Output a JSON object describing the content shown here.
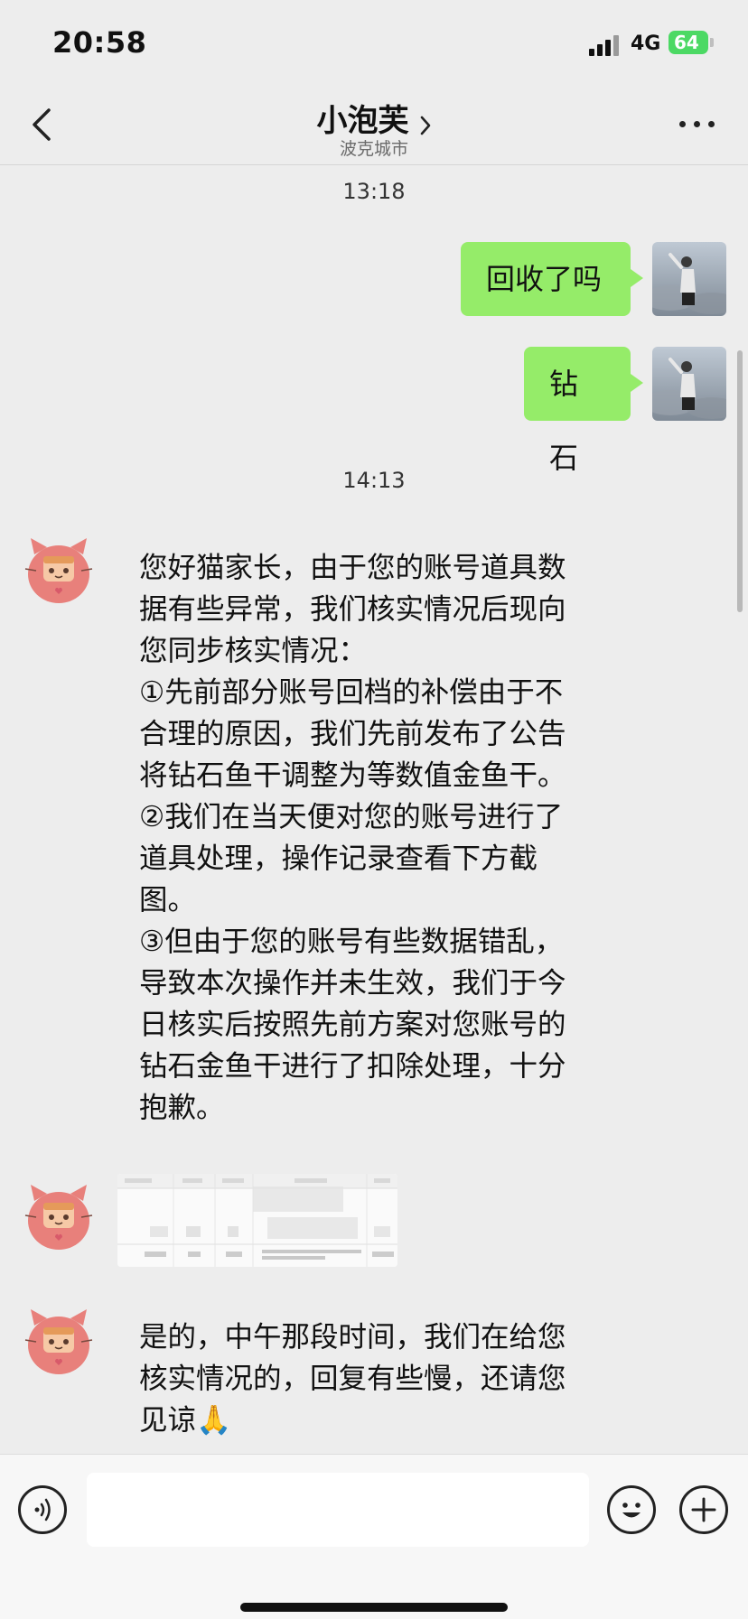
{
  "status_bar": {
    "time": "20:58",
    "network": "4G",
    "battery": "64"
  },
  "nav": {
    "title": "小泡芙",
    "subtitle": "波克城市"
  },
  "messages": {
    "timestamp_1": "13:18",
    "out_1": "回收了吗",
    "out_2": "钻石",
    "timestamp_2": "14:13",
    "in_1": [
      "您好猫家长，由于您的账号道具数",
      "据有些异常，我们核实情况后现向",
      "您同步核实情况：",
      "①先前部分账号回档的补偿由于不",
      "合理的原因，我们先前发布了公告",
      "将钻石鱼干调整为等数值金鱼干。",
      "②我们在当天便对您的账号进行了",
      "道具处理，操作记录查看下方截",
      "图。",
      "③但由于您的账号有些数据错乱，",
      "导致本次操作并未生效，我们于今",
      "日核实后按照先前方案对您账号的",
      "钻石金鱼干进行了扣除处理，十分",
      "抱歉。"
    ],
    "in_image_caption": "",
    "in_3": [
      "是的，中午那段时间，我们在给您",
      "核实情况的，回复有些慢，还请您",
      "见谅🙏"
    ]
  },
  "icons": {
    "back": "chevron-left-icon",
    "more": "more-dots-icon",
    "voice": "voice-icon",
    "emoji": "emoji-icon",
    "plus": "plus-icon"
  },
  "colors": {
    "outgoing_bubble": "#95ec69",
    "background": "#ededed",
    "battery": "#4cd964"
  },
  "input": {
    "placeholder": ""
  }
}
